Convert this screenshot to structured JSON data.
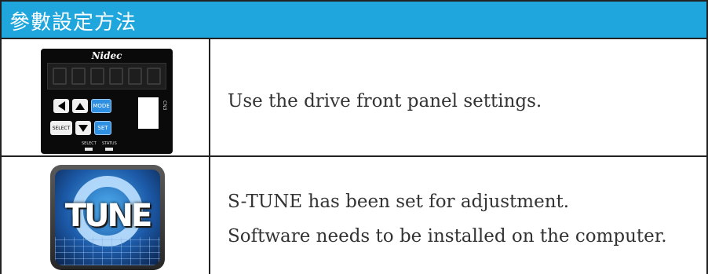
{
  "header": {
    "title": "參數設定方法"
  },
  "rows": [
    {
      "image": {
        "type": "drive-front-panel",
        "logo": "Nidec",
        "buttons": {
          "mode": "MODE",
          "select": "SELECT",
          "set": "SET"
        },
        "leds": [
          "SELECT",
          "STATUS"
        ],
        "port": "CN3"
      },
      "lines": [
        "Use the drive front panel settings."
      ]
    },
    {
      "image": {
        "type": "s-tune-logo",
        "text": "TUNE"
      },
      "lines": [
        "S-TUNE has been set for adjustment.",
        "Software needs to be installed on the computer."
      ]
    }
  ]
}
